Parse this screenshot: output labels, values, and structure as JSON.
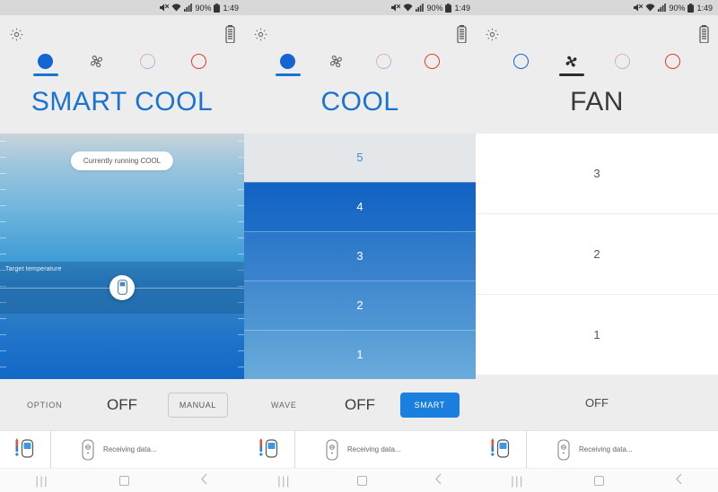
{
  "statusbar": {
    "mute_icon": "mute-icon",
    "wifi_icon": "wifi-icon",
    "signal_icon": "signal-icon",
    "battery_percent": "90%",
    "battery_icon": "battery-icon",
    "time": "1:49"
  },
  "nav": {
    "recents": "|||",
    "home_icon": "home-icon",
    "back_icon": "back-icon"
  },
  "bottom_bar": {
    "thermometer_icon": "thermometer-icon",
    "remote_icon": "remote-icon",
    "status_text": "Receiving data..."
  },
  "tabs": [
    {
      "name": "cool",
      "icon": "cool-dot-icon"
    },
    {
      "name": "fan",
      "icon": "fan-icon"
    },
    {
      "name": "auto",
      "icon": "auto-ring-icon"
    },
    {
      "name": "heat",
      "icon": "heat-ring-icon"
    }
  ],
  "panels": [
    {
      "id": "smart-cool",
      "gear_icon": "gear-icon",
      "battery_remote_icon": "remote-battery-icon",
      "title": "SMART COOL",
      "title_color": "#1a73d0",
      "selected_tab": 0,
      "running_pill": "Currently running COOL",
      "target_label": "Target temperature",
      "handle_icon": "remote-handle-icon",
      "option_left": "OPTION",
      "option_mid": "OFF",
      "option_button": "MANUAL"
    },
    {
      "id": "cool",
      "gear_icon": "gear-icon",
      "battery_remote_icon": "remote-battery-icon",
      "title": "COOL",
      "title_color": "#1a73d0",
      "selected_tab": 0,
      "levels": [
        {
          "label": "5",
          "selected": false
        },
        {
          "label": "4",
          "selected": true
        },
        {
          "label": "3",
          "selected": true
        },
        {
          "label": "2",
          "selected": true
        },
        {
          "label": "1",
          "selected": true
        }
      ],
      "option_left": "WAVE",
      "option_mid": "OFF",
      "option_button": "SMART",
      "option_button_color": "#1b7fe0"
    },
    {
      "id": "fan",
      "gear_icon": "gear-icon",
      "battery_remote_icon": "remote-battery-icon",
      "title": "FAN",
      "title_color": "#383838",
      "selected_tab": 1,
      "levels": [
        {
          "label": "3"
        },
        {
          "label": "2"
        },
        {
          "label": "1"
        }
      ],
      "off_label": "OFF"
    }
  ]
}
